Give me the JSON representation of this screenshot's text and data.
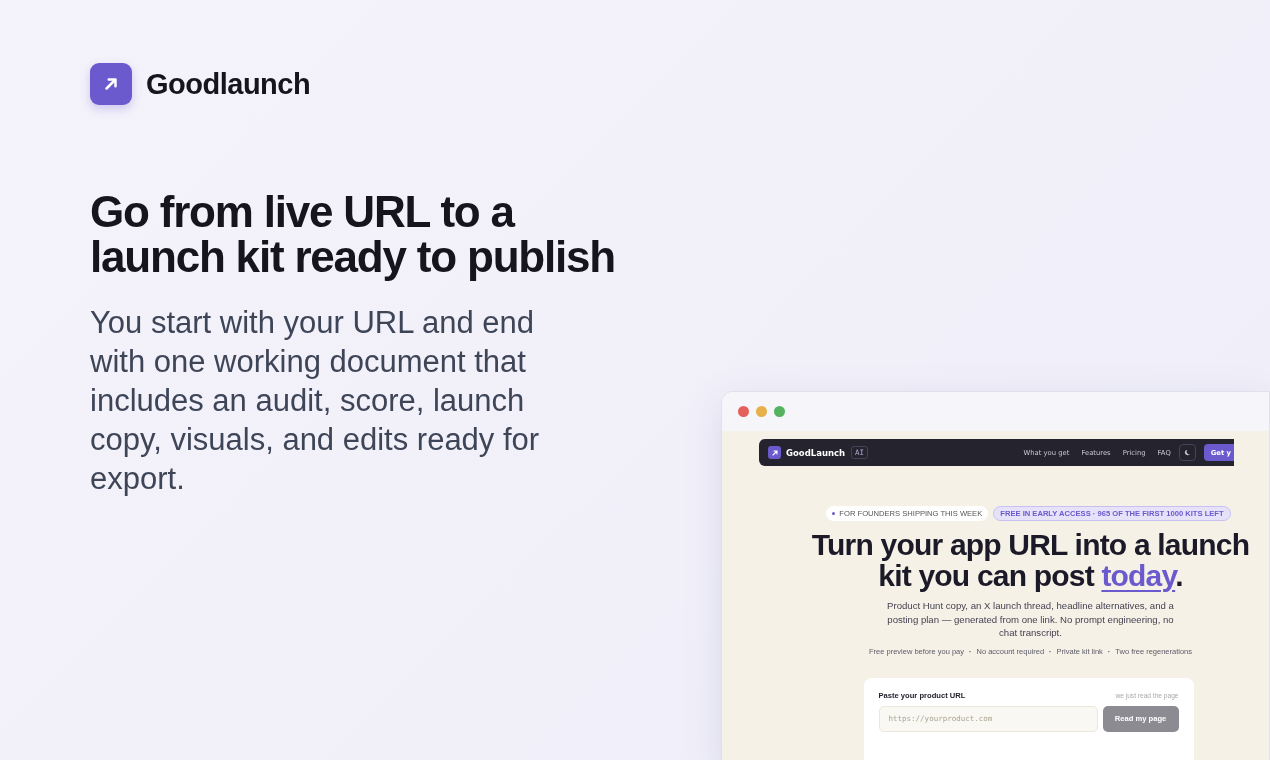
{
  "brand": {
    "name": "Goodlaunch"
  },
  "hero": {
    "title": "Go from live URL to a launch kit ready to publish",
    "description": "You start with your URL and end with one working document that includes an audit, score, launch copy, visuals, and edits ready for export."
  },
  "preview": {
    "window_controls": [
      {
        "color": "#e5605a"
      },
      {
        "color": "#e8b04a"
      },
      {
        "color": "#55b35f"
      }
    ],
    "navbar": {
      "brand": "GoodLaunch",
      "badge": "AI",
      "links": [
        "What you get",
        "Features",
        "Pricing",
        "FAQ"
      ],
      "cta": "Get y"
    },
    "pills": [
      {
        "kind": "plain",
        "text": "FOR FOUNDERS SHIPPING THIS WEEK"
      },
      {
        "kind": "accent",
        "text": "FREE IN EARLY ACCESS · 965 OF THE FIRST 1000 KITS LEFT"
      }
    ],
    "headline": "Turn your app URL into a launch kit you can post *today*.",
    "subtitle": "Product Hunt copy, an X launch thread, headline alternatives, and a posting plan — generated from one link. No prompt engineering, no chat transcript.",
    "perk_separator": "·",
    "perks": [
      "Free preview before you pay",
      "No account required",
      "Private kit link",
      "Two free regenerations"
    ],
    "form": {
      "label": "Paste your product URL",
      "hint": "we just read the page",
      "placeholder": "https://yourproduct.com",
      "button": "Read my page",
      "disabled": true
    }
  }
}
